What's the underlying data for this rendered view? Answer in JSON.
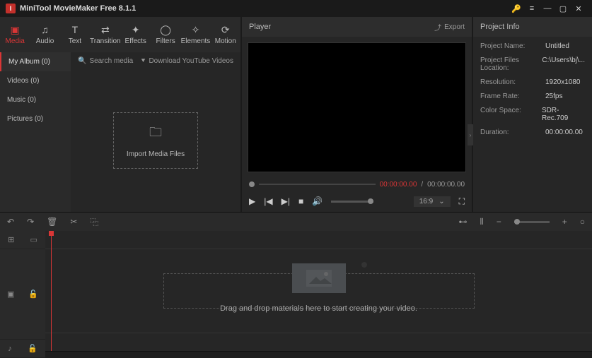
{
  "titlebar": {
    "title": "MiniTool MovieMaker Free 8.1.1"
  },
  "tabs": {
    "media": "Media",
    "audio": "Audio",
    "text": "Text",
    "transition": "Transition",
    "effects": "Effects",
    "filters": "Filters",
    "elements": "Elements",
    "motion": "Motion"
  },
  "albums": {
    "my_album": "My Album (0)",
    "videos": "Videos (0)",
    "music": "Music (0)",
    "pictures": "Pictures (0)"
  },
  "media_area": {
    "search": "Search media",
    "download": "Download YouTube Videos",
    "import": "Import Media Files"
  },
  "player": {
    "header": "Player",
    "export": "Export",
    "time_current": "00:00:00.00",
    "time_sep": " / ",
    "time_total": "00:00:00.00",
    "ratio": "16:9"
  },
  "project_info": {
    "header": "Project Info",
    "rows": {
      "name_lbl": "Project Name:",
      "name_val": "Untitled",
      "loc_lbl": "Project Files Location:",
      "loc_val": "C:\\Users\\bj\\...",
      "res_lbl": "Resolution:",
      "res_val": "1920x1080",
      "fps_lbl": "Frame Rate:",
      "fps_val": "25fps",
      "cs_lbl": "Color Space:",
      "cs_val": "SDR- Rec.709",
      "dur_lbl": "Duration:",
      "dur_val": "00:00:00.00"
    }
  },
  "timeline": {
    "hint": "Drag and drop materials here to start creating your video."
  }
}
